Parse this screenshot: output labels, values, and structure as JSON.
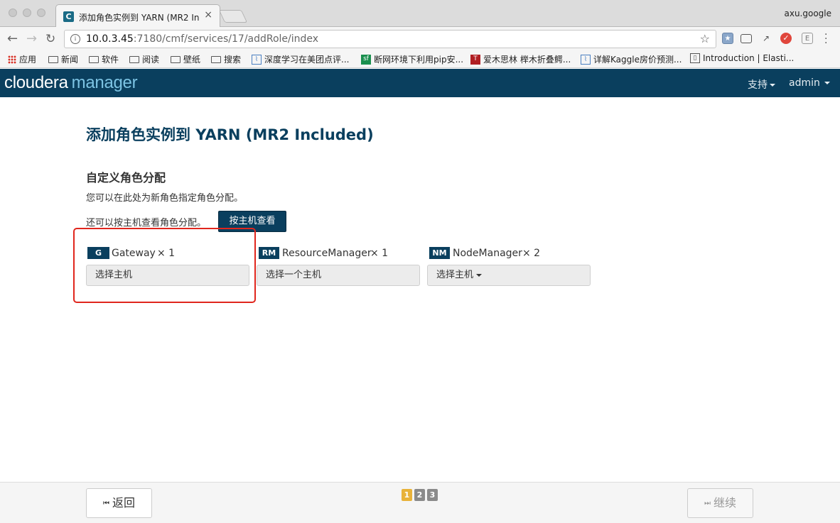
{
  "browser": {
    "tab_title": "添加角色实例到 YARN (MR2 Inc",
    "tab_favicon_letter": "C",
    "profile_name": "axu.google",
    "url_host": "10.0.3.45",
    "url_path": ":7180/cmf/services/17/addRole/index",
    "bookmarks": [
      {
        "label": "应用",
        "icon": "apps-grid-icon"
      },
      {
        "label": "新闻",
        "icon": "folder-icon"
      },
      {
        "label": "软件",
        "icon": "folder-icon"
      },
      {
        "label": "阅读",
        "icon": "folder-icon"
      },
      {
        "label": "壁纸",
        "icon": "folder-icon"
      },
      {
        "label": "搜索",
        "icon": "folder-icon"
      },
      {
        "label": "深度学习在美团点评...",
        "icon": "chart-favicon-icon"
      },
      {
        "label": "断网环境下利用pip安...",
        "icon": "sf-favicon-icon",
        "letter": "sf"
      },
      {
        "label": "爱木思林 榉木折叠鳄...",
        "icon": "t-favicon-icon",
        "letter": "T"
      },
      {
        "label": "详解Kaggle房价预测...",
        "icon": "chart-favicon-icon"
      },
      {
        "label": "Introduction | Elasti...",
        "icon": "book-favicon-icon"
      }
    ]
  },
  "header": {
    "logo_cloudera": "cloudera",
    "logo_manager": "manager",
    "support_label": "支持",
    "user_label": "admin"
  },
  "content": {
    "page_title": "添加角色实例到 YARN (MR2 Included)",
    "section_title": "自定义角色分配",
    "description": "您可以在此处为新角色指定角色分配。",
    "view_by_host_text": "还可以按主机查看角色分配。",
    "view_by_host_button": "按主机查看",
    "roles": [
      {
        "badge": "G",
        "name": "Gateway",
        "count": "× 1",
        "select_label": "选择主机"
      },
      {
        "badge": "RM",
        "name": "ResourceManager",
        "count": "× 1",
        "select_label": "选择一个主机"
      },
      {
        "badge": "NM",
        "name": "NodeManager",
        "count": "× 2",
        "select_label": "选择主机"
      }
    ]
  },
  "footer": {
    "back_label": "返回",
    "continue_label": "继续",
    "steps": [
      "1",
      "2",
      "3"
    ],
    "active_step": "1"
  },
  "colors": {
    "brand_dark": "#0a3f5e",
    "brand_light": "#7cc3e3",
    "highlight": "#e0261d",
    "step_active": "#e8b23a",
    "step_inactive": "#8a8a8a"
  }
}
